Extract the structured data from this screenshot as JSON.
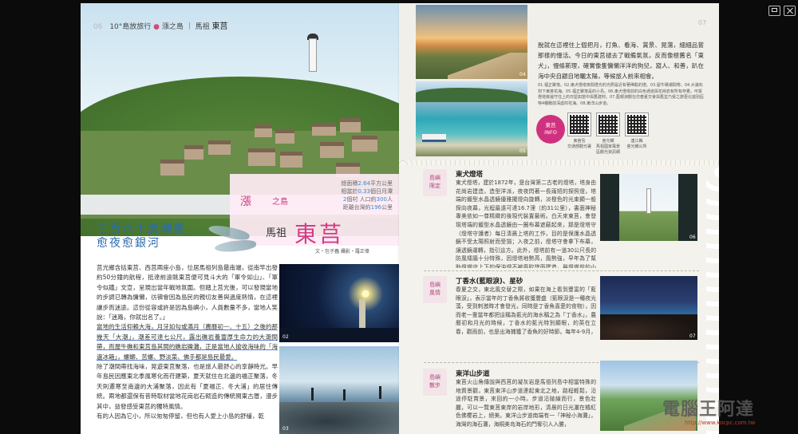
{
  "left": {
    "header": {
      "page_no": "06",
      "series": "10°島放旅行",
      "section": "漲之島",
      "region": "馬祖",
      "place": "東莒"
    },
    "photo_num_01": "01",
    "title_block": {
      "series_left": "漲",
      "series_right": "之島",
      "stats": [
        {
          "pre": "總面積",
          "val": "2.64",
          "post": "平方公里"
        },
        {
          "pre": "相當於",
          "val": "0.33",
          "post": "個日月潭"
        },
        {
          "pre": "",
          "val": "2",
          "post": "個村 人口約",
          "val2": "300",
          "post2": "人"
        },
        {
          "pre": "距離台灣約",
          "val": "196",
          "post": "公里"
        }
      ],
      "region": "馬祖",
      "title": "東莒",
      "credit": "文・包子蟲 攝影・羅正偉"
    },
    "headline": [
      "三百六十度潮差",
      "愈夜愈銀河"
    ],
    "body": [
      "莒光鄉含括東莒、西莒兩座小島，位居馬祖列島最南端，從南竿出發約50分鐘的航程，抵達前遠眺東莒便可見斗大的「軍令如山」、「軍令似鐵」文宣，呈現出當年戰地氛圍。但踏上莒光後，可以發現當地的步調已轉為慵懶，彷彿會因為島民的親切友善與過度熱情，在這裡讓步而迷途。這份從容或許是因為島嶼小，人員數量不多，當地人笑說：「迷路，你就出名了。」",
      "當地的生活仰賴大海，月牙如勾或滿月（農曆初一、十五）之後的那幾天「大潮」，潮差可達七公尺，露出礁岩養豐厚生命力的大潮間帶，而屋牛礁和東莒島其間的礁岩礫灘，正是當地人搶收海味的「海邊冰箱」，螺螄、苦螺、野淡菜、佛手都是島民最愛。",
      "除了潮間帶找海味，晃遊東莒聚落，也是旅人最舒心的享靜時光。早年島民因應東北季風寒化而苻建築，夏天就住在北邊的福正聚落，冬天則遷寒至南邊的大浦聚落，因此有「夏福正、冬大浦」的居住傳統。兩地都還保有昔時取材當地花崗岩石砌造的傳統閩東古厝，漫步其中，益發感受東莒的獨特風情。",
      "有的人因為它小，所以匆匆停留，但也有人愛上小島的舒緩，乾"
    ],
    "photo_num_02": "02",
    "photo_num_03": "03"
  },
  "right": {
    "page_no": "07",
    "photo_num_04": "04",
    "photo_num_05": "05",
    "intro": "脫就在這裡住上個把月，打魚、看海、賞景、晃蕩，細細品嘗那樣的慢活。今日的東莒褪去了戰備氣氛，反而像極舊名「東犬」，慢條斯理，確實像隻慵懶洋洋的狗兒，窩人、和善，趴在海中央自顧自地曬太陽，等候旅人前來相會。",
    "captions": "01.福正聚落。02.東犬燈塔夜間燈光的光照是近有著稀鬆的燈。03.屋牛礁潮間帶。04.大浦石刻下東莒花海。05.福正聚落是的小島。06.東犬燈塔前的白色通道與花崗岩有所有存覺。可駕燈塔旁邊守住上的日堅如當中與舊建材。07.藍眼淚觀在仿春夏交會與舊並乃受之旅更北遊別區特4種戰前深處的花海。08.東洋山步道。",
    "info": {
      "line1": "東莒",
      "line2": "INFO"
    },
    "qr_labels": [
      {
        "a": "東莒島",
        "b": "交通部觀光署"
      },
      {
        "a": "莒光鄉",
        "b": "馬祖國家風景",
        "c": "區觀光資訊網"
      },
      {
        "a": "連江縣",
        "b": "莒光鄉公所"
      }
    ],
    "sections": [
      {
        "tag1": "島嶼",
        "tag2": "限定",
        "title": "東犬燈塔",
        "body": "東犬燈塔，建於1872年，是台灣第二古老的燈塔，塔身由花崗岩建造，造型洋派，夜夜閃著一長兩短的探照燈，塔端的鍍型水晶透鏡優雅擺燈向旋轉，淡橙色的光束顯一般探向夜幕，光程最遠可達16.7浬（約31公里），書面神秘專美依如一尊精緻的後現代裝置藝術。白天來東莒，會發現塔端的鍍型水晶透鏡由一圈布幕遮蔽起來，那是燈塔守（燈塔守護者）每日清晨上塔的工作，目的是保護水晶透鏡不受太陽照射而受損；入夜之前，燈塔守會拿下布幕，讓透鏡運轉，指引這方。此外，燈塔前有一道30公尺長的防風矮牆十分特殊，因燈塔地勢高，風勢強，早年為了幫助燈塔守上下的保油燈不被風吹墜而建造，與燈塔前的小型博物館都為晉日遺跡，裡頭陳列的資訊與古物，正好展細訴說著東莒的海上歲月。",
        "photo_num": "06"
      },
      {
        "tag1": "島嶼",
        "tag2": "風情",
        "title": "丁香水(藍眼淚)、星砂",
        "body": "春夏之交，東北風交替之際，如果在海上看到豐富的「藍眼淚」，表示當年的丁香魚將收獲豐盛（藍眼淚是一種夜光藻，受到刺激時才會發光，同時是丁香魚喜愛的食物），因而老一輩當年都把這稱為藍光的海水稱之為「丁香水」，農曆初和月光的時候，丁香水的藍光特別顯眼，的英在立春，觀雨前，也是出海捕獲了香魚的好時節。每年4-9月，如果喚得夜間在東莒的福正沙灘，遊能遇到和藍眼淚一樣讓人著迷的小生物：星砂（介形蟲），只要在沙灘上腳意走走，就會發現後方腳印裡發出一閃一閃的「星光」，讓人驚喜不已。",
        "photo_num": "07"
      },
      {
        "tag1": "島嶼",
        "tag2": "散步",
        "title": "東洋山步道",
        "body": "東莒火山角傳說與西莒的凝灰岩是馬祖列島中相當特殊的地質景觀，東莒東洋山步道連起東北之地，路程輕鬆，沿途停駐賞景，來回約一小時。步道沿陵線而行，景色壯麗，可以一覽東莒東岸的岩岸地形，清晨的日光灑在橘紅色佛櫻岩上，絕美。東洋山步道南端有一「神秘小海灘」，海灣的海石灘，海桐美岛海石的門奪引人入勝，"
      }
    ]
  },
  "watermark": {
    "text": "電腦王阿達",
    "url": "http://www.kocpc.com.tw"
  }
}
